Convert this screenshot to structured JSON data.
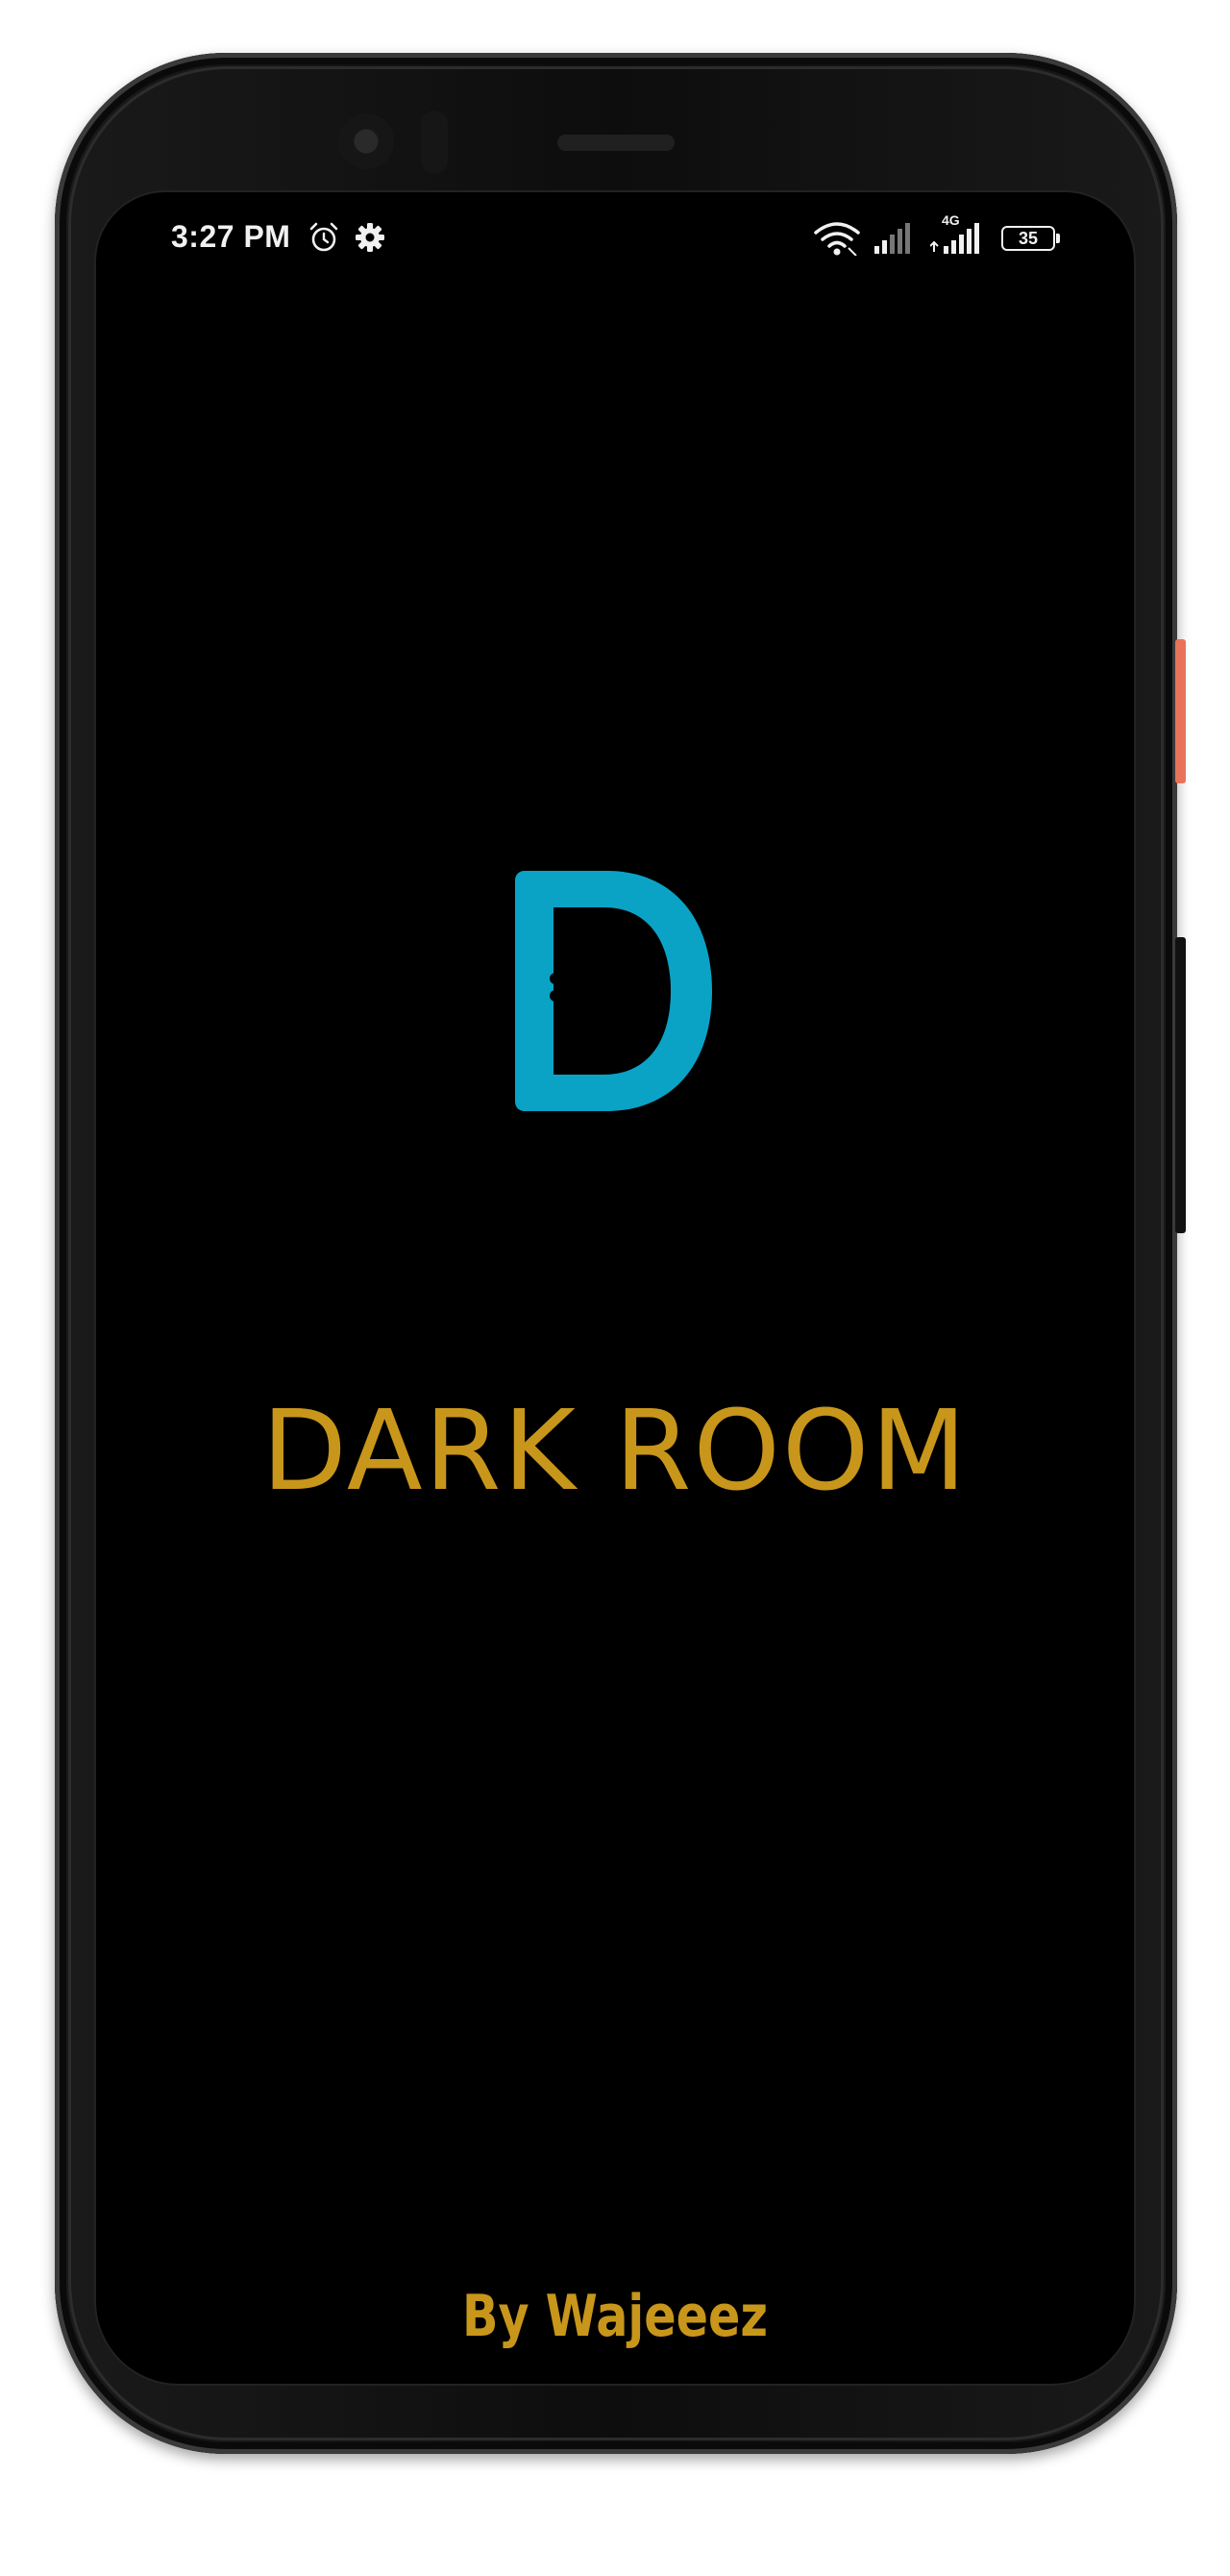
{
  "status_bar": {
    "time": "3:27 PM",
    "icons": [
      "alarm-icon",
      "settings-icon",
      "wifi-icon",
      "signal-icon",
      "signal-4g-icon",
      "battery-icon"
    ],
    "network_label": "4G",
    "battery_level": "35"
  },
  "splash": {
    "logo_letter": "D",
    "logo_color": "#0aa3c6",
    "title": "DARK ROOM",
    "title_color": "#c8961a",
    "byline": "By Wajeeez",
    "byline_color": "#c8961a"
  },
  "navigation": {
    "buttons": [
      "recents-button",
      "home-button",
      "back-button"
    ]
  }
}
